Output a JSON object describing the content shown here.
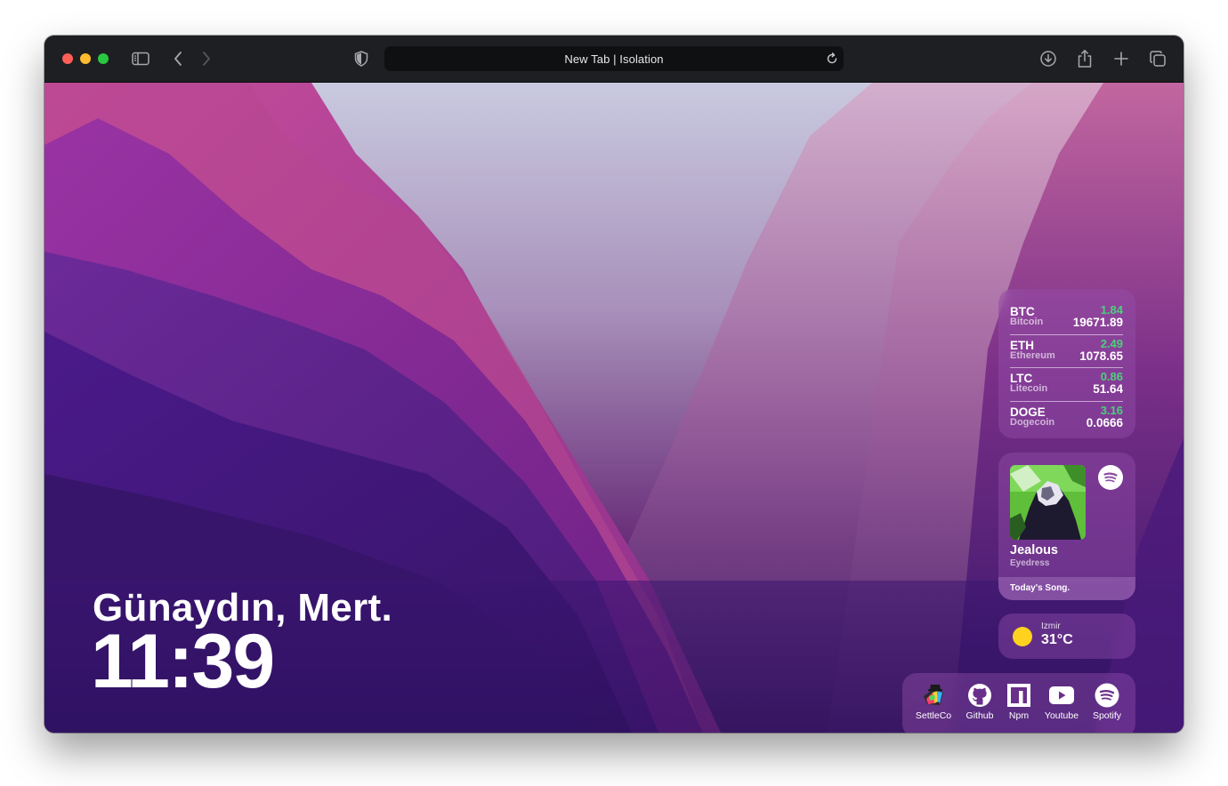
{
  "browser": {
    "title": "New Tab | Isolation",
    "buttons": {
      "sidebar": "sidebar-icon",
      "back": "back-icon",
      "forward": "forward-icon",
      "shield": "shield-icon",
      "reload": "reload-icon",
      "downloads": "download-icon",
      "share": "share-icon",
      "new_tab": "plus-icon",
      "tabs": "tab-overview-icon"
    }
  },
  "greeting": {
    "text": "Günaydın, Mert.",
    "time": "11:39"
  },
  "crypto": [
    {
      "symbol": "BTC",
      "name": "Bitcoin",
      "change": "1.84",
      "price": "19671.89"
    },
    {
      "symbol": "ETH",
      "name": "Ethereum",
      "change": "2.49",
      "price": "1078.65"
    },
    {
      "symbol": "LTC",
      "name": "Litecoin",
      "change": "0.86",
      "price": "51.64"
    },
    {
      "symbol": "DOGE",
      "name": "Dogecoin",
      "change": "3.16",
      "price": "0.0666"
    }
  ],
  "song": {
    "title": "Jealous",
    "artist": "Eyedress",
    "footer": "Today's Song."
  },
  "weather": {
    "city": "Izmir",
    "temp": "31°C"
  },
  "shortcuts": [
    {
      "label": "SettleCo",
      "icon": "settleco-icon"
    },
    {
      "label": "Github",
      "icon": "github-icon"
    },
    {
      "label": "Npm",
      "icon": "npm-icon"
    },
    {
      "label": "Youtube",
      "icon": "youtube-icon"
    },
    {
      "label": "Spotify",
      "icon": "spotify-icon"
    }
  ],
  "colors": {
    "positive_change": "#4cd07a",
    "traffic_red": "#fe5f57",
    "traffic_yellow": "#febc2e",
    "traffic_green": "#28c840",
    "sun": "#ffd21f"
  }
}
